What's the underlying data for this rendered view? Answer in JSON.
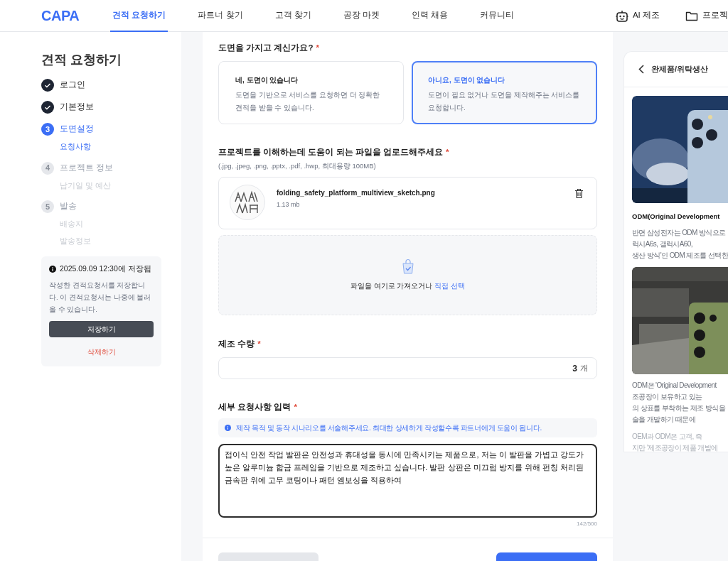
{
  "header": {
    "logo": "CAPA",
    "nav": [
      {
        "label": "견적 요청하기",
        "selected": true
      },
      {
        "label": "파트너 찾기",
        "selected": false
      },
      {
        "label": "고객 찾기",
        "selected": false
      },
      {
        "label": "공장 마켓",
        "selected": false
      },
      {
        "label": "인력 채용",
        "selected": false
      },
      {
        "label": "커뮤니티",
        "selected": false
      }
    ],
    "actions": [
      {
        "kind": "robot",
        "label": "AI 제조"
      },
      {
        "kind": "folder",
        "label": "프로젝"
      }
    ]
  },
  "sidebar": {
    "title": "견적 요청하기",
    "steps": [
      {
        "label": "로그인",
        "done": true,
        "current": false
      },
      {
        "label": "기본정보",
        "done": true,
        "current": false
      },
      {
        "number": "3",
        "label": "도면설정",
        "done": false,
        "current": true,
        "substeps": [
          "요청사항"
        ]
      },
      {
        "number": "4",
        "label": "프로젝트 정보",
        "done": false,
        "current": false,
        "substeps": [
          "납기일 및 예산"
        ]
      },
      {
        "number": "5",
        "label": "발송",
        "done": false,
        "current": false,
        "substeps": [
          "배송지",
          "발송정보"
        ]
      }
    ],
    "save_card": {
      "saved_at": "2025.09.09 12:30에 저장됨",
      "description": "작성한 견적요청서를 저장합니다. 이 견적요청서는 나중에 불러올 수 있습니다.",
      "save_button": "저장하기",
      "delete_link": "삭제하기"
    }
  },
  "form": {
    "drawing_question": {
      "label": "도면을 가지고 계신가요?",
      "required": "*",
      "options": [
        {
          "title": "네, 도면이 있습니다",
          "description": "도면을 기반으로 서비스를 요청하면 더 정확한 견적을 받을 수 있습니다.",
          "selected": false
        },
        {
          "title": "아니요, 도면이 없습니다",
          "description": "도면이 필요 없거나 도면을 제작해주는 서비스를 요청합니다.",
          "selected": true
        }
      ]
    },
    "upload": {
      "label": "프로젝트를 이해하는데 도움이 되는 파일을 업로드해주세요",
      "required": "*",
      "hint": "(.jpg, .jpeg, .png, .pptx, .pdf, .hwp, 최대용량 100MB)",
      "files": [
        {
          "name": "folding_safety_platform_multiview_sketch.png",
          "size": "1.13 mb"
        }
      ],
      "dropzone_text": "파일을 여기로 가져오거나",
      "dropzone_link": "직접 선택"
    },
    "quantity": {
      "label": "제조 수량",
      "required": "*",
      "value": "3",
      "unit": "개"
    },
    "details": {
      "label": "세부 요청사항 입력",
      "required": "*",
      "info": "제작 목적 및 동작 시나리오를 서술해주세요. 최대한 상세하게 작성할수록 파트너에게 도움이 됩니다.",
      "value": "접이식 안전 작업 발판은 안전성과 휴대성을 동시에 만족시키는 제품으로, 저는 이 발판을 가볍고 강도가 높은 알루미늄 합금 프레임을 기반으로 제조하고 싶습니다. 발판 상판은 미끄럼 방지를 위해 펀칭 처리된 금속판 위에 고무 코팅이나 패턴 엠보싱을 적용하여",
      "count": "142/500"
    }
  },
  "side_panel": {
    "title": "완제품/위탁생산",
    "articles": [
      {
        "kind": "picture"
      },
      {
        "kind": "heading",
        "text": "ODM(Original Development"
      },
      {
        "kind": "paragraph",
        "lines": [
          "반면 삼성전자는 ODM 방식으로",
          "럭시A6s, 갤럭시A60,",
          "생산 방식'인 ODM 제조를 선택한"
        ],
        "faded": false
      },
      {
        "kind": "picture"
      },
      {
        "kind": "paragraph",
        "lines": [
          "ODM은 'Original Development",
          "조공장이 보유하고 있는",
          "의 상표를 부착하는 제조 방식을",
          "술을 개발하기 때문에"
        ],
        "faded": false
      },
      {
        "kind": "paragraph",
        "lines": [
          "OEM과 ODM은 고객, 즉",
          "지만 '제조공장이 제품 개발에"
        ],
        "faded": true
      }
    ]
  }
}
